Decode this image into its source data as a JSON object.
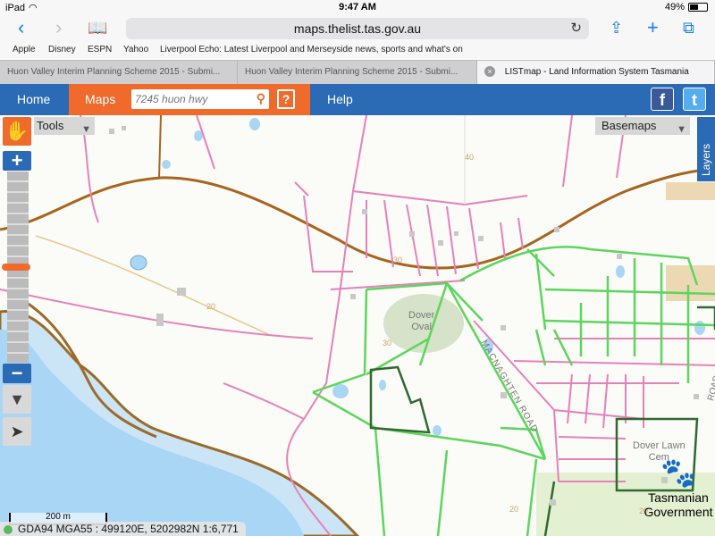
{
  "status_bar": {
    "device": "iPad",
    "time": "9:47 AM",
    "battery": "49%"
  },
  "browser": {
    "url": "maps.thelist.tas.gov.au",
    "bookmarks": [
      "Apple",
      "Disney",
      "ESPN",
      "Yahoo",
      "Liverpool Echo: Latest Liverpool and Merseyside news, sports and what's on"
    ],
    "tabs": [
      {
        "label": "Huon Valley Interim Planning Scheme 2015 - Submi..."
      },
      {
        "label": "Huon Valley Interim Planning Scheme 2015 - Submi..."
      },
      {
        "label": "LISTmap - Land Information System Tasmania"
      }
    ]
  },
  "app_header": {
    "home_label": "Home",
    "maps_label": "Maps",
    "search_placeholder": "7245 huon hwy",
    "help_label": "?",
    "help_nav_label": "Help",
    "facebook_glyph": "f",
    "twitter_glyph": "t"
  },
  "map": {
    "tools_label": "Tools",
    "basemaps_label": "Basemaps",
    "layers_label": "Layers",
    "zoom_in_label": "+",
    "zoom_out_label": "−",
    "zoom_level_fraction": 0.5,
    "scale_label": "200 m",
    "coords_label": "GDA94 MGA55 : 499120E, 5202982N 1:6,771",
    "labels": {
      "oval": "Dover\nOval",
      "road": "MACNAGHTEN ROAD",
      "cem": "Dover Lawn\nCem",
      "road_short": "ROAD"
    },
    "contours": [
      "40",
      "30",
      "20",
      "30",
      "20",
      "20"
    ],
    "logo_line1": "Tasmanian",
    "logo_line2": "Government",
    "colors": {
      "parcel": "#e880b8",
      "zone_green": "#5cd65c",
      "zone_dark": "#2f6a2f",
      "road": "#a8651e",
      "water": "#a9d6f5",
      "shore": "#9a6b2a"
    }
  }
}
